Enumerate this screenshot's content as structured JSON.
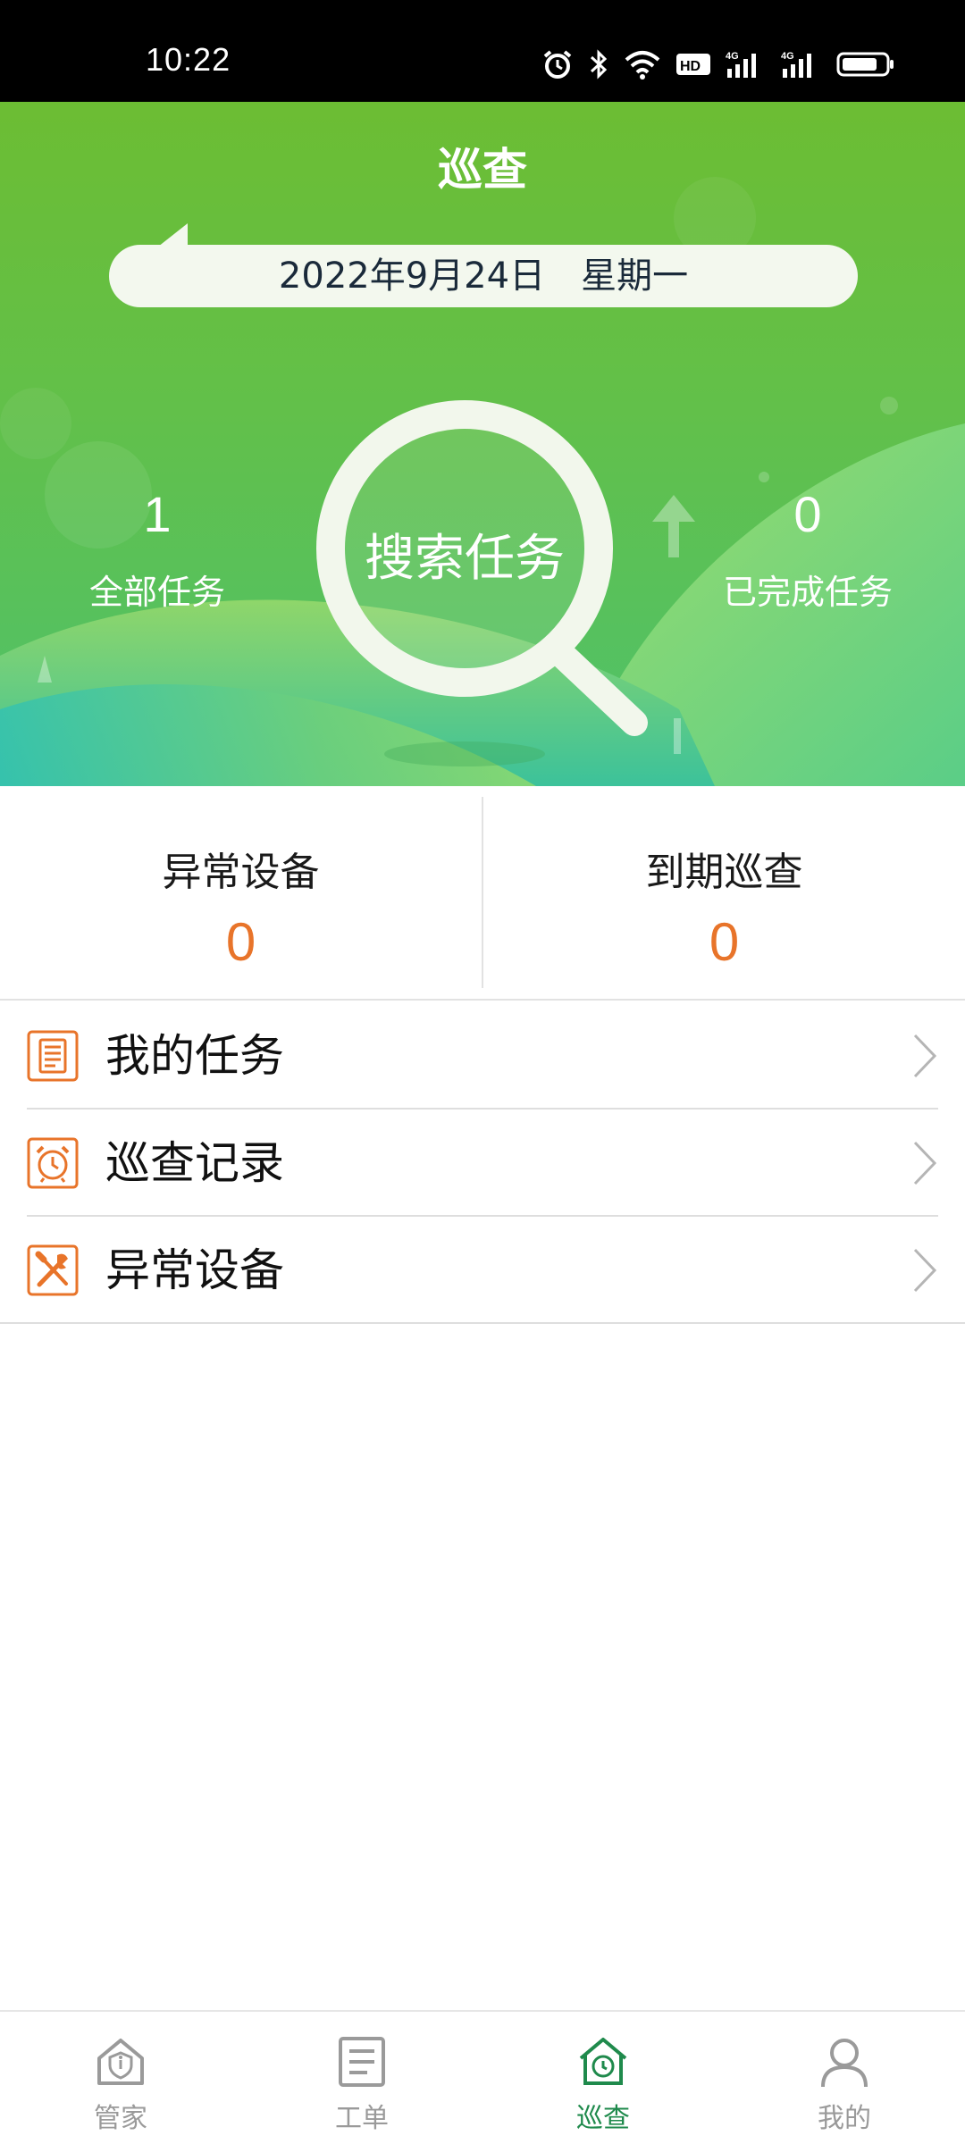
{
  "status_bar": {
    "time": "10:22"
  },
  "header": {
    "title": "巡查",
    "date": "2022年9月24日",
    "weekday": "星期一"
  },
  "hero": {
    "search_label": "搜索任务",
    "total_tasks": {
      "value": "1",
      "label": "全部任务"
    },
    "completed_tasks": {
      "value": "0",
      "label": "已完成任务"
    }
  },
  "stats": [
    {
      "label": "异常设备",
      "value": "0"
    },
    {
      "label": "到期巡查",
      "value": "0"
    }
  ],
  "menu": [
    {
      "label": "我的任务",
      "icon": "document-icon"
    },
    {
      "label": "巡查记录",
      "icon": "alarm-clock-icon"
    },
    {
      "label": "异常设备",
      "icon": "tools-icon"
    }
  ],
  "bottom_nav": [
    {
      "label": "管家",
      "icon": "home-shield-icon",
      "active": false
    },
    {
      "label": "工单",
      "icon": "document-list-icon",
      "active": false
    },
    {
      "label": "巡查",
      "icon": "house-inspect-icon",
      "active": true
    },
    {
      "label": "我的",
      "icon": "person-icon",
      "active": false
    }
  ],
  "colors": {
    "hero_green": "#6cbd33",
    "accent_orange": "#e8742a",
    "nav_active": "#1f8a4c"
  }
}
